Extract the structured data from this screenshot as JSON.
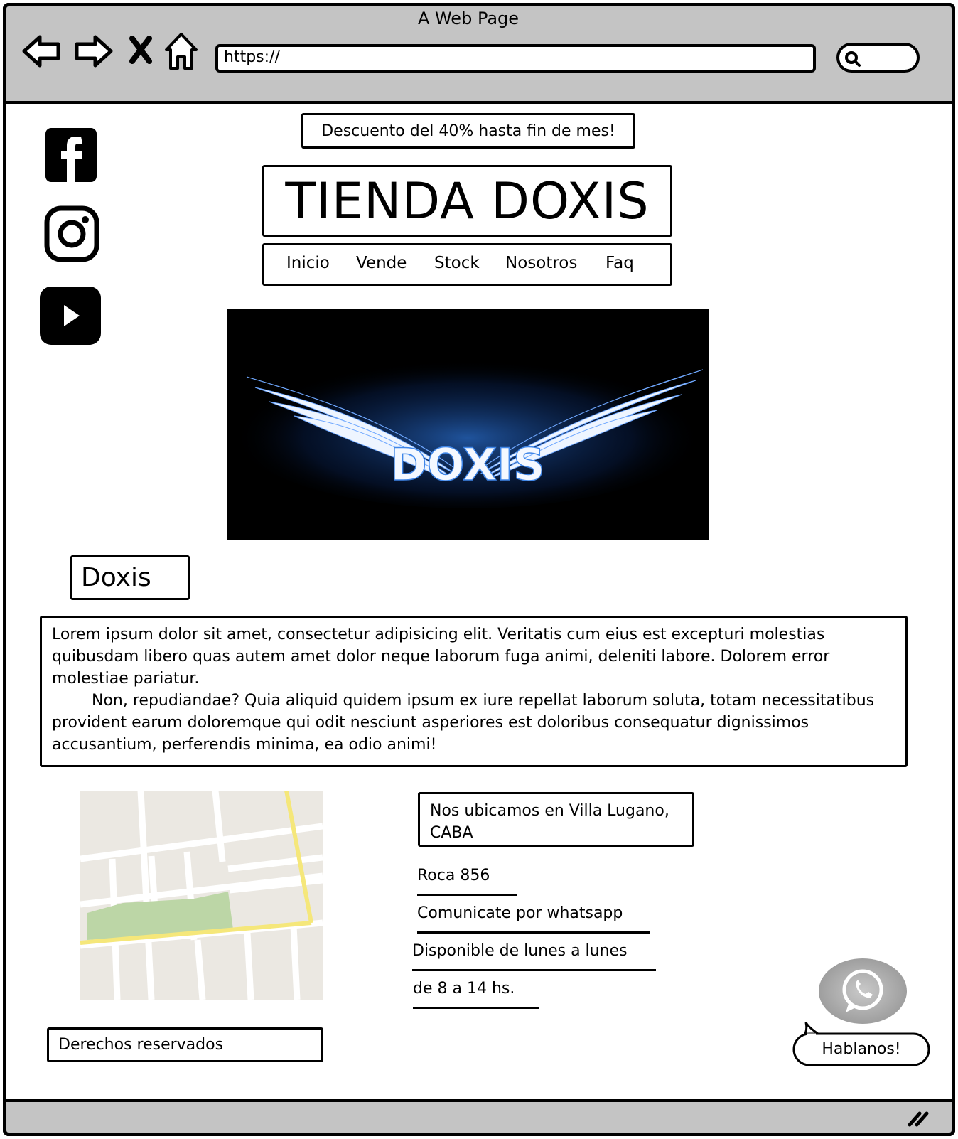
{
  "browser": {
    "title": "A Web Page",
    "url": "https://",
    "nav_icons": [
      "back-arrow-icon",
      "forward-arrow-icon",
      "close-x-icon",
      "home-icon"
    ],
    "search_icon": "search-icon",
    "resize_icon": "resize-grip-icon"
  },
  "social": {
    "icons": [
      "facebook-icon",
      "instagram-icon",
      "youtube-icon"
    ]
  },
  "promo": {
    "text": "Descuento del 40% hasta fin de mes!"
  },
  "header": {
    "title": "TIENDA DOXIS"
  },
  "nav": {
    "items": [
      {
        "label": "Inicio"
      },
      {
        "label": "Vende"
      },
      {
        "label": "Stock"
      },
      {
        "label": "Nosotros"
      },
      {
        "label": "Faq"
      }
    ]
  },
  "hero": {
    "logo_text": "DOXIS",
    "colors": {
      "background": "#000000",
      "glow": "#1e5aa8",
      "wing": "#e8f1ff"
    }
  },
  "section": {
    "heading": "Doxis",
    "paragraph1": "Lorem ipsum dolor sit amet, consectetur adipisicing elit. Veritatis cum eius est excepturi molestias quibusdam libero quas autem amet dolor neque laborum fuga animi, deleniti labore. Dolorem error molestiae pariatur.",
    "paragraph2": "Non, repudiandae? Quia aliquid quidem ipsum ex iure repellat laborum soluta, totam necessitatibus provident earum doloremque qui odit nesciunt asperiores est doloribus consequatur dignissimos accusantium, perferendis minima, ea odio animi!"
  },
  "location": {
    "headline": "Nos ubicamos en Villa Lugano, CABA",
    "lines": [
      "Roca 856",
      "Comunicate por whatsapp",
      "Disponible de lunes a lunes",
      "de 8 a 14 hs."
    ]
  },
  "map": {
    "colors": {
      "land": "#ebe8e2",
      "road": "#ffffff",
      "main_road": "#f5e77a",
      "park": "#bcd6a6"
    }
  },
  "footer": {
    "rights": "Derechos reservados"
  },
  "chat": {
    "whatsapp_icon": "whatsapp-icon",
    "bubble_label": "Hablanos!"
  }
}
